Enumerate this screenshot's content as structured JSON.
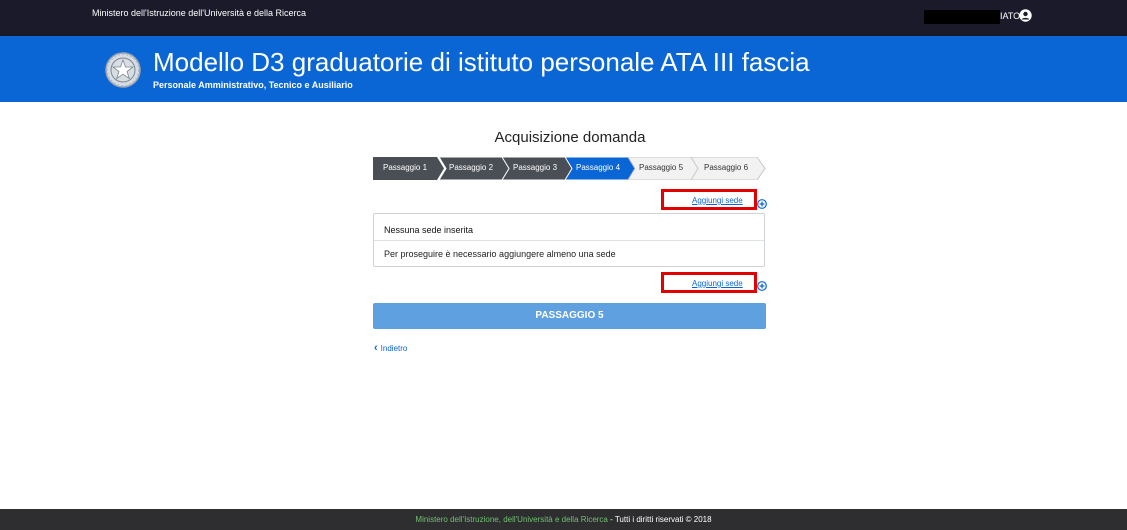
{
  "topbar": {
    "ministry": "Ministero dell'Istruzione dell'Università e della Ricerca",
    "user_label": "IATO",
    "user_icon": "user-circle-icon"
  },
  "header": {
    "emblem_icon": "republic-emblem-icon",
    "title": "Modello D3 graduatorie di istituto personale ATA III fascia",
    "subtitle": "Personale Amministrativo, Tecnico e Ausiliario"
  },
  "main": {
    "heading": "Acquisizione domanda",
    "steps": [
      {
        "label": "Passaggio 1",
        "state": "done"
      },
      {
        "label": "Passaggio 2",
        "state": "done"
      },
      {
        "label": "Passaggio 3",
        "state": "done"
      },
      {
        "label": "Passaggio 4",
        "state": "active"
      },
      {
        "label": "Passaggio 5",
        "state": "todo"
      },
      {
        "label": "Passaggio 6",
        "state": "todo"
      }
    ],
    "add_link_top": "Aggiungi sede",
    "add_link_bottom": "Aggiungi sede",
    "add_icon": "plus-circle-icon",
    "panel": {
      "title": "Nessuna sede inserita",
      "message": "Per proseguire è necessario aggiungere almeno una sede"
    },
    "next_button": "PASSAGGIO 5",
    "back_link": "Indietro",
    "back_icon": "chevron-left-icon"
  },
  "footer": {
    "link_text": "Ministero dell'Istruzione, dell'Università e della Ricerca",
    "rest_text": " - Tutti i diritti riservati © 2018"
  },
  "colors": {
    "header_blue": "#0a66d4",
    "step_done": "#4a4f55",
    "step_active": "#0a66d4",
    "step_todo": "#f2f2f2",
    "highlight_red": "#e30000",
    "button_blue": "#5ea0e0"
  }
}
